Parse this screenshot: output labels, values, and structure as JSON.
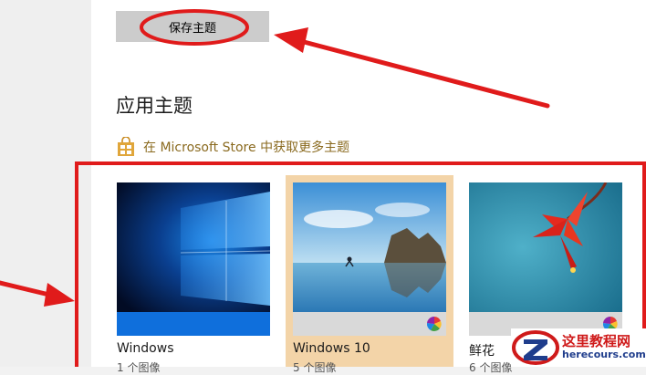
{
  "toolbar": {
    "save_label": "保存主题"
  },
  "section": {
    "title": "应用主题"
  },
  "store_link": {
    "label": "在 Microsoft Store 中获取更多主题"
  },
  "themes": [
    {
      "name": "Windows",
      "count": "1 个图像"
    },
    {
      "name": "Windows 10",
      "count": "5 个图像",
      "selected": true
    },
    {
      "name": "鲜花",
      "count": "6 个图像"
    }
  ],
  "watermark": {
    "title": "这里教程网",
    "url": "herecours.com"
  },
  "colors": {
    "annotation_red": "#e01b1b",
    "store_link": "#8a6a1f",
    "selected_theme_bg": "#f3d4a8",
    "button_bg": "#cccccc"
  },
  "icons": {
    "store": "store-bag-icon",
    "color_wheel": "color-wheel-icon"
  }
}
